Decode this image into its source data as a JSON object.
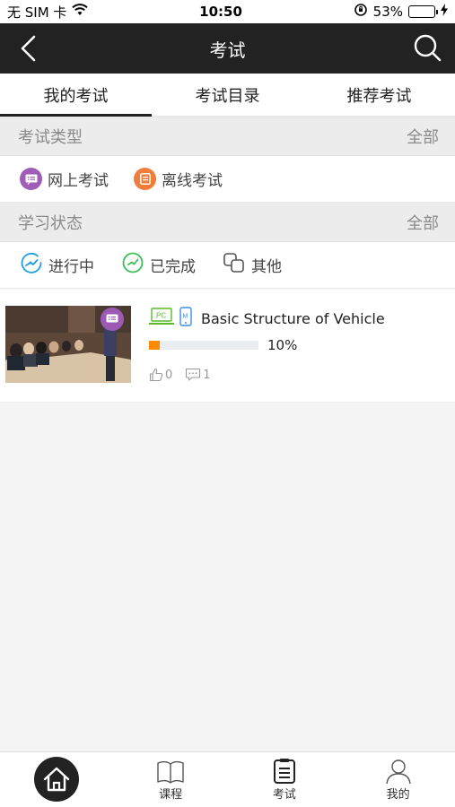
{
  "status_bar": {
    "carrier": "无 SIM 卡",
    "time": "10:50",
    "battery_percent": "53%",
    "battery_level": 0.53
  },
  "nav": {
    "title": "考试",
    "back_icon": "chevron-left-icon",
    "search_icon": "search-icon"
  },
  "tabs": [
    {
      "label": "我的考试",
      "active": true
    },
    {
      "label": "考试目录",
      "active": false
    },
    {
      "label": "推荐考试",
      "active": false
    }
  ],
  "exam_type": {
    "title": "考试类型",
    "all_label": "全部",
    "options": [
      {
        "label": "网上考试",
        "icon": "online-exam-icon",
        "color": "#a05db8"
      },
      {
        "label": "离线考试",
        "icon": "offline-exam-icon",
        "color": "#f07d3a"
      }
    ]
  },
  "study_status": {
    "title": "学习状态",
    "all_label": "全部",
    "options": [
      {
        "label": "进行中",
        "icon": "in-progress-icon",
        "color": "#1ea0e0"
      },
      {
        "label": "已完成",
        "icon": "completed-icon",
        "color": "#3cbf54"
      },
      {
        "label": "其他",
        "icon": "other-icon",
        "color": "#555555"
      }
    ]
  },
  "courses": [
    {
      "title": "Basic Structure of Vehicle",
      "pc_label": "PC",
      "mobile_label": "M",
      "progress_text": "10%",
      "progress": 0.1,
      "likes": "0",
      "comments": "1"
    }
  ],
  "tabbar": {
    "home_icon": "home-icon",
    "items": [
      {
        "label": "课程",
        "icon": "book-icon"
      },
      {
        "label": "考试",
        "icon": "exam-icon"
      },
      {
        "label": "我的",
        "icon": "user-icon"
      }
    ]
  },
  "colors": {
    "nav_bg": "#222222",
    "accent_orange": "#ff8a00",
    "battery_green": "#4cd964"
  }
}
